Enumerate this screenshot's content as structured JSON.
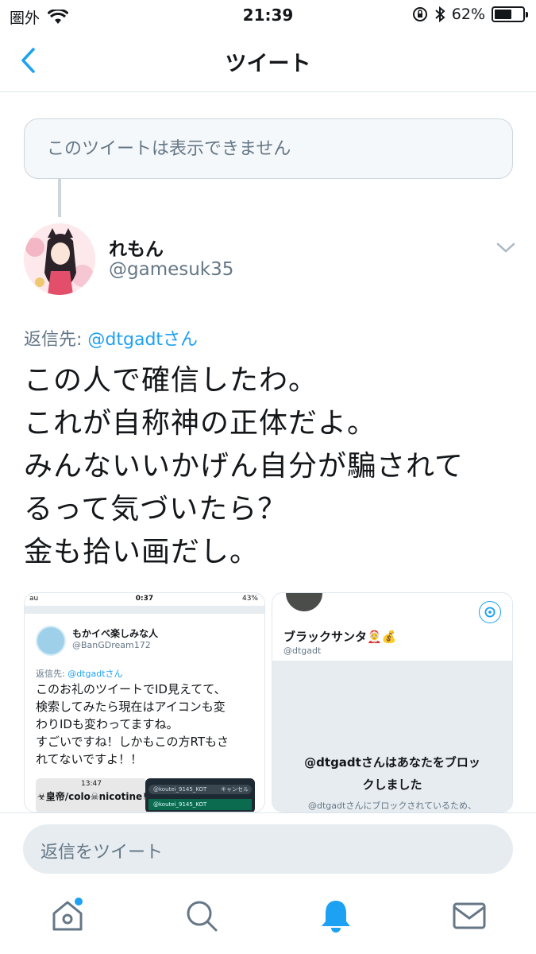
{
  "status_bar": {
    "carrier": "圏外",
    "time": "21:39",
    "battery": "62%",
    "battery_level": 0.62,
    "icons": [
      "wifi-icon",
      "rotation-lock-icon",
      "bluetooth-icon",
      "battery-icon"
    ]
  },
  "nav": {
    "title": "ツイート",
    "back_icon": "chevron-left-icon"
  },
  "unavailable_tweet": {
    "text": "このツイートは表示できません"
  },
  "tweet": {
    "display_name": "れもん",
    "handle": "@gamesuk35",
    "reply_prefix": "返信先: ",
    "reply_to": "@dtgadtさん",
    "lines": [
      "この人で確信したわ。",
      "これが自称神の正体だよ。",
      "みんないいかげん自分が騙されて",
      "るって気づいたら？",
      "金も拾い画だし。"
    ]
  },
  "media": {
    "left": {
      "status_left": "au",
      "status_time": "0:37",
      "status_battery": "43%",
      "name": "もかイベ楽しみな人",
      "handle": "@BanGDream172",
      "reply_prefix": "返信先: ",
      "reply_to": "@dtgadtさん",
      "lines": [
        "このお礼のツイートでID見えてて、",
        "検索してみたら現在はアイコンも変",
        "わりIDも変わってますね。",
        "すごいですね！しかもこの方RTもさ",
        "れてないですよ！！"
      ],
      "sub1_time": "13:47",
      "sub1_name": "☣皇帝/colo☠nicotine⚑",
      "sub2_search": "@koutei_9145_KOT",
      "sub2_cancel": "キャンセル",
      "sub2_row": "@koutei_9145_KOT"
    },
    "right": {
      "name": "ブラックサンタ🤶💰",
      "handle": "@dtgadt",
      "block_title_1": "@dtgadtさんはあなたをブロッ",
      "block_title_2": "クしました",
      "block_sub": "@dtgadtさんにブロックされているため、"
    }
  },
  "reply_box": {
    "placeholder": "返信をツイート"
  },
  "tabbar": {
    "items": [
      "home-icon",
      "search-icon",
      "notifications-icon",
      "messages-icon"
    ],
    "active": "notifications-icon",
    "active_color": "#1da1f2",
    "inactive_color": "#657786"
  },
  "colors": {
    "accent": "#1da1f2",
    "muted": "#657786",
    "border": "#e1e8ed"
  }
}
